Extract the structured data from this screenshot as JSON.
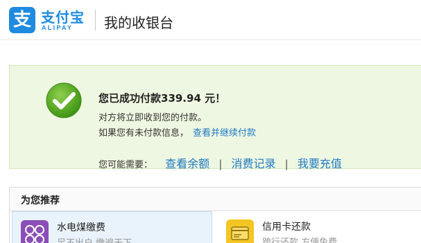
{
  "header": {
    "brand_cn": "支付宝",
    "brand_en": "ALIPAY",
    "page_title": "我的收银台"
  },
  "success": {
    "title": "您已成功付款339.94 元！",
    "notice_line1": "对方将立即收到您的付款。",
    "notice_line2": "如果您有未付款信息，",
    "notice_link": "查看并继续付款",
    "needs_label": "您可能需要：",
    "links": [
      "查看余额",
      "消费记录",
      "我要充值"
    ],
    "separator": "|"
  },
  "recommend": {
    "title": "为您推荐",
    "items": [
      {
        "name": "水电煤缴费",
        "desc": "足不出户 缴遍天下",
        "icon": "utilities-icon",
        "color": "#8b4db8"
      },
      {
        "name": "信用卡还款",
        "desc": "跨行还款 方便免费",
        "icon": "credit-card-icon",
        "color": "#f3c623"
      }
    ]
  },
  "colors": {
    "brand": "#1e8be0",
    "link": "#1f7ac4",
    "success_bg": "#eef7e1",
    "check": "#5aab22"
  }
}
